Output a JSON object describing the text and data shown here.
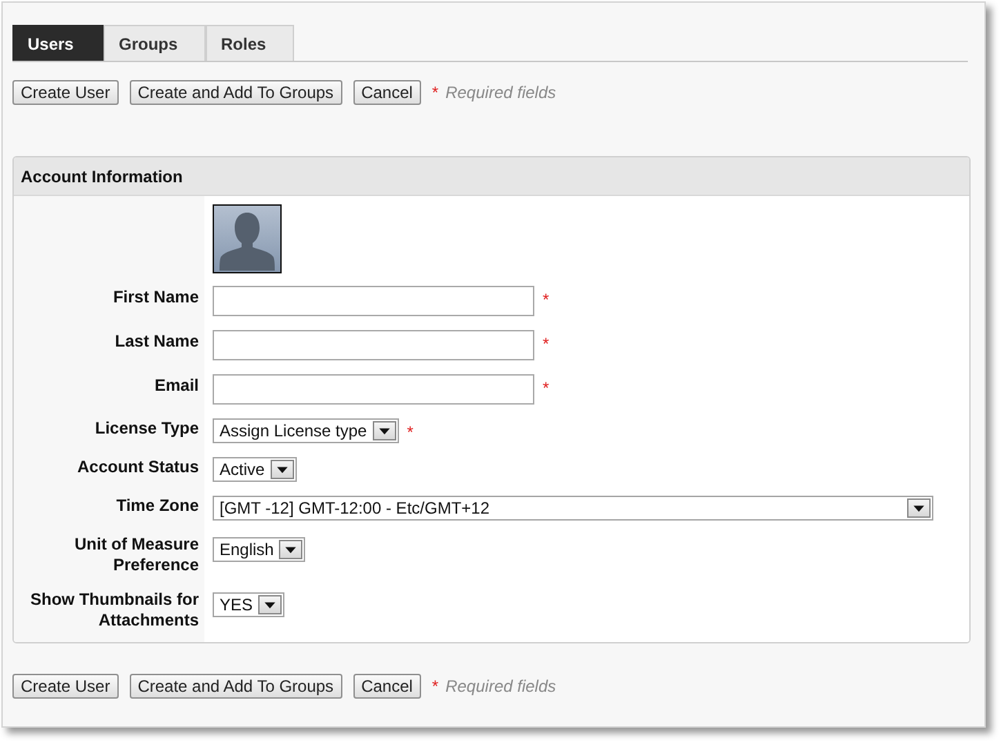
{
  "tabs": [
    {
      "label": "Users",
      "selected": true
    },
    {
      "label": "Groups",
      "selected": false
    },
    {
      "label": "Roles",
      "selected": false
    }
  ],
  "top_actions": {
    "buttons": [
      "Create User",
      "Create and Add To Groups",
      "Cancel"
    ],
    "required_mark": "*",
    "required_note": "Required fields"
  },
  "account_information": {
    "title": "Account Information",
    "rows": [
      {
        "kind": "avatar"
      },
      {
        "kind": "text",
        "label": "First Name",
        "required_mark": "*"
      },
      {
        "kind": "text",
        "label": "Last Name",
        "required_mark": "*"
      },
      {
        "kind": "text",
        "label": "Email",
        "required_mark": "*"
      },
      {
        "kind": "select",
        "label": "License Type",
        "value": "Assign License type",
        "required_mark": "*"
      },
      {
        "kind": "select",
        "label": "Account Status",
        "value": "Active"
      },
      {
        "kind": "select",
        "label": "Time Zone",
        "value": "[GMT -12] GMT-12:00 - Etc/GMT+12",
        "full_width": true
      },
      {
        "kind": "select",
        "label": "Unit of Measure Preference",
        "value": "English"
      },
      {
        "kind": "select",
        "label": "Show Thumbnails for Attachments",
        "value": "YES"
      }
    ]
  },
  "bottom_actions": {
    "buttons": [
      "Create User",
      "Create and Add To Groups",
      "Cancel"
    ],
    "required_mark": "*",
    "required_note": "Required fields"
  }
}
